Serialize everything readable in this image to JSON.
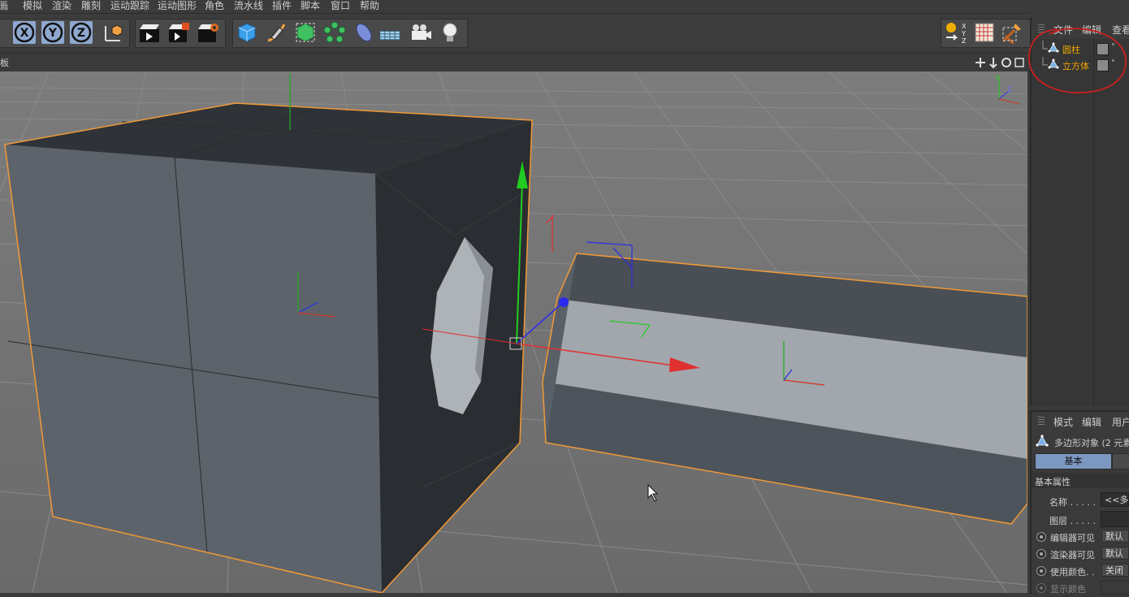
{
  "menu": [
    "动画",
    "模拟",
    "渲染",
    "雕刻",
    "运动跟踪",
    "运动图形",
    "角色",
    "流水线",
    "插件",
    "脚本",
    "窗口",
    "帮助"
  ],
  "menu_first_partial": "画",
  "toolbar": {
    "axis_lock_x_icon": "x-lock-icon",
    "axis_lock_y_icon": "y-lock-icon",
    "axis_lock_z_icon": "z-lock-icon",
    "coord_icon": "coordinate-system-icon",
    "render_view_icon": "render-view-icon",
    "render_picture_icon": "render-picture-icon",
    "render_settings_icon": "render-settings-icon",
    "cube_icon": "cube-primitive-icon",
    "pen_icon": "pen-spline-icon",
    "subdivide_icon": "subdivision-icon",
    "array_icon": "array-cloner-icon",
    "deformer_icon": "deformer-icon",
    "floor_icon": "floor-icon",
    "camera_icon": "camera-icon",
    "light_icon": "light-bulb-icon",
    "right_xyz_icon": "coord-xyz-icon",
    "right_texture_icon": "texture-icon",
    "right_sculpt_icon": "sculpt-icon"
  },
  "viewport": {
    "header_label": "板",
    "nav_icons": [
      "move-view-icon",
      "pan-view-icon",
      "rotate-view-icon",
      "maximize-view-icon"
    ],
    "axis_y_label": "Y",
    "axis_z_label": "Z"
  },
  "object_manager": {
    "tabs": [
      "文件",
      "编辑",
      "查看"
    ],
    "objects": [
      {
        "name": "圆柱",
        "icon": "polygon-object-icon"
      },
      {
        "name": "立方体",
        "icon": "polygon-object-icon"
      }
    ]
  },
  "attributes": {
    "tabs": [
      "模式",
      "编辑",
      "用户"
    ],
    "object_title": "多边形对象 (2 元素",
    "tab_basic": "基本",
    "section": "基本属性",
    "name_label": "名称 . . . . .",
    "name_value": "<<多重",
    "layer_label": "图层 . . . . .",
    "editor_visible_label": "编辑器可见",
    "editor_visible_value": "默认",
    "render_visible_label": "渲染器可见",
    "render_visible_value": "默认",
    "use_color_label": "使用颜色. .",
    "use_color_value": "关闭",
    "display_color_label": "显示颜色"
  },
  "colors": {
    "selection_outline": "#f09a36",
    "annotation_circle": "#cc1f1f",
    "axis_x": "#e03030",
    "axis_y": "#22cc22",
    "axis_z": "#2a2aee",
    "object_name": "#f0a500"
  }
}
